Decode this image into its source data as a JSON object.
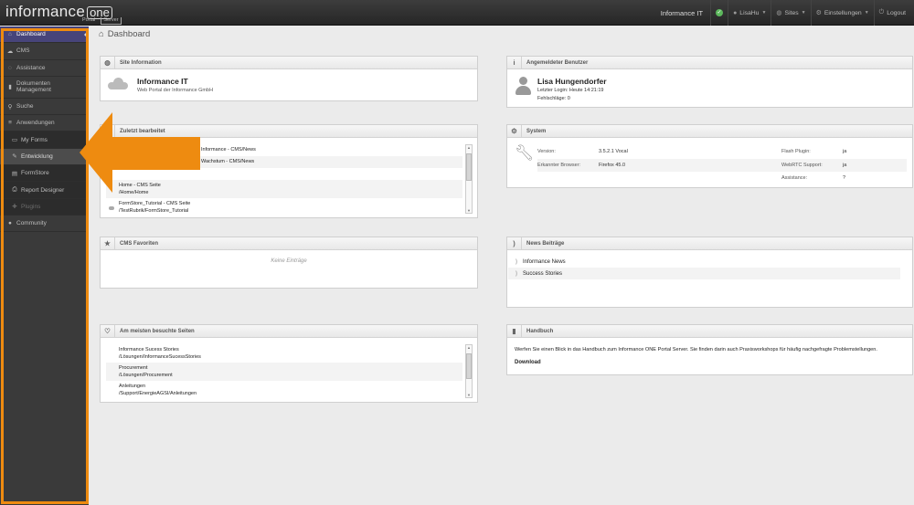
{
  "colors": {
    "accent": "#ee8b10",
    "active_nav": "#47447a",
    "topbar": "#2d2d2d",
    "status_ok": "#5cb85c"
  },
  "brand": {
    "name": "informance",
    "one": "one",
    "portal": "Portal",
    "server": "Server"
  },
  "topbar": {
    "organization": "Informance IT",
    "user": "LisaHu",
    "sites": "Sites",
    "settings": "Einstellungen",
    "logout": "Logout"
  },
  "sidebar": {
    "items": [
      {
        "label": "Dashboard",
        "icon": "home-icon",
        "glyph": "⌂"
      },
      {
        "label": "CMS",
        "icon": "cloud-icon",
        "glyph": "☁"
      },
      {
        "label": "Assistance",
        "icon": "chat-icon",
        "glyph": "◌"
      },
      {
        "label": "Dokumenten Management",
        "icon": "bookmark-icon",
        "glyph": "▮"
      },
      {
        "label": "Suche",
        "icon": "search-icon",
        "glyph": "⚲"
      },
      {
        "label": "Anwendungen",
        "icon": "menu-icon",
        "glyph": "≡"
      },
      {
        "label": "My Forms",
        "icon": "monitor-icon",
        "glyph": "▭"
      },
      {
        "label": "Entwicklung",
        "icon": "edit-icon",
        "glyph": "✎"
      },
      {
        "label": "FormStore",
        "icon": "list-icon",
        "glyph": "▤"
      },
      {
        "label": "Report Designer",
        "icon": "print-icon",
        "glyph": "⎙"
      },
      {
        "label": "Plugins",
        "icon": "puzzle-icon",
        "glyph": "✚"
      },
      {
        "label": "Community",
        "icon": "user-icon",
        "glyph": "●"
      }
    ]
  },
  "breadcrumb": {
    "title": "Dashboard"
  },
  "site_info": {
    "title": "Site Information",
    "name": "Informance IT",
    "subtitle": "Web Portal der Informance GmbH"
  },
  "user_info": {
    "title": "Angemeldeter Benutzer",
    "name": "Lisa Hungendorfer",
    "last_login": "Letzter Login: Heute 14:21:19",
    "errors": "Fehlschläge: 0"
  },
  "recent": {
    "title": "Zuletzt bearbeitet",
    "rows": [
      {
        "line1": "Informance - CMS/News",
        "line2": ""
      },
      {
        "line1": "Wachstum - CMS/News",
        "line2": ""
      },
      {
        "line1": "",
        "line2": ""
      },
      {
        "line1": "Home - CMS Seite",
        "line2": "/Home/Home"
      },
      {
        "line1": "FormStore_Tutorial - CMS Seite",
        "line2": "/TestRubrik/FormStore_Tutorial"
      }
    ]
  },
  "system": {
    "title": "System",
    "rows": [
      {
        "k": "Version:",
        "v": "3.5.2.1 Vocal",
        "k2": "Flash Plugin:",
        "v2": "ja"
      },
      {
        "k": "Erkannter Browser:",
        "v": "Firefox 45.0",
        "k2": "WebRTC Support:",
        "v2": "ja"
      },
      {
        "k": "",
        "v": "",
        "k2": "Assistance:",
        "v2": "?"
      }
    ]
  },
  "favorites": {
    "title": "CMS Favoriten",
    "empty": "Keine Einträge"
  },
  "news": {
    "title": "News Beiträge",
    "items": [
      "Informance News",
      "Success Stories"
    ]
  },
  "visited": {
    "title": "Am meisten besuchte Seiten",
    "rows": [
      {
        "line1": "Informance Sucess Stories",
        "line2": "/Lösungen/InformanceSucessStories"
      },
      {
        "line1": "Procurement",
        "line2": "/Lösungen/Procurement"
      },
      {
        "line1": "Anleitungen",
        "line2": "/Support/EnergieAGSI/Anleitungen"
      }
    ]
  },
  "handbook": {
    "title": "Handbuch",
    "text": "Werfen Sie einen Blick in das Handbuch zum Informance ONE Portal Server. Sie finden darin auch Praxisworkshops für häufig nachgefragte Problemstellungen.",
    "link": "Download"
  }
}
